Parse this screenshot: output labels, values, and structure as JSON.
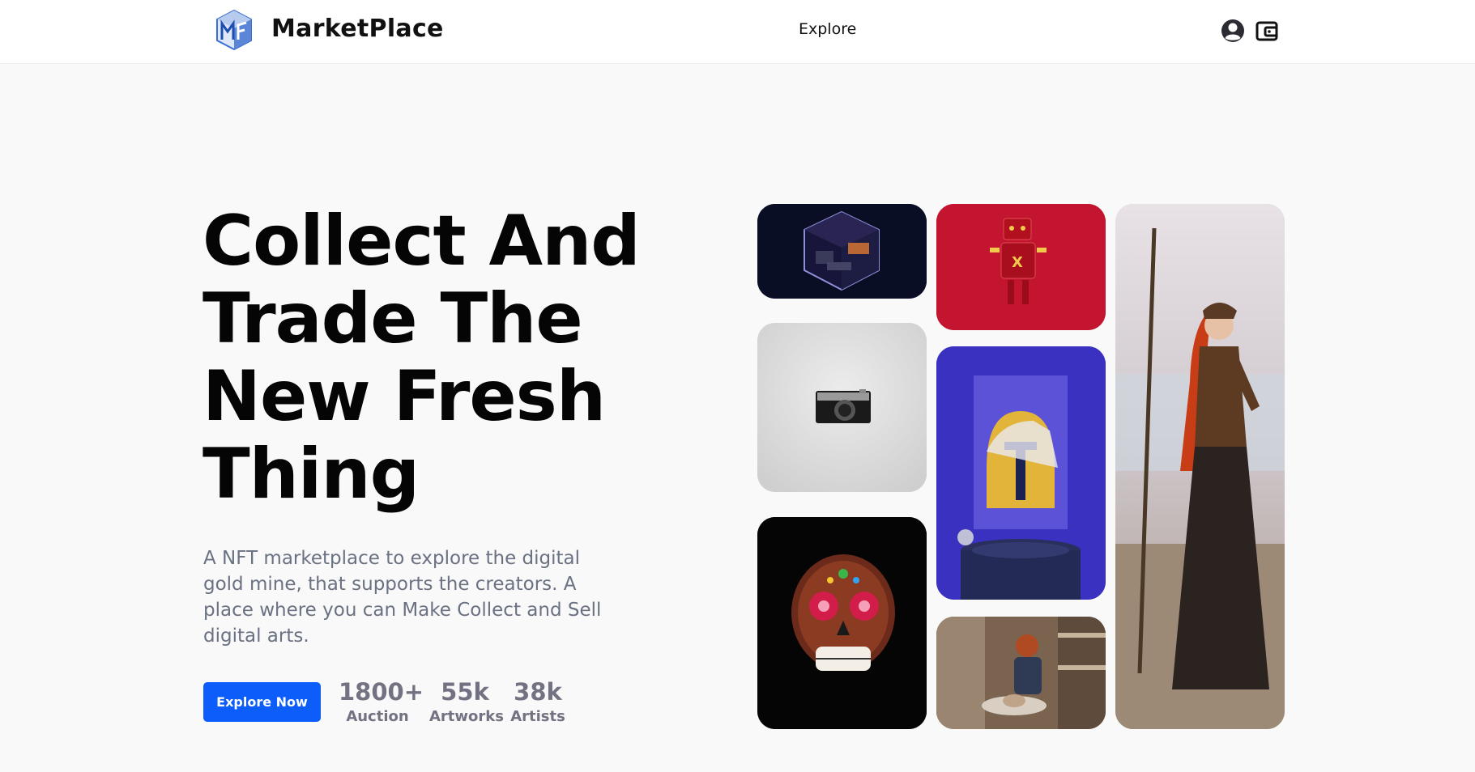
{
  "navbar": {
    "brand": "MarketPlace",
    "links": [
      "Explore"
    ],
    "icons": [
      "user-icon",
      "wallet-icon"
    ]
  },
  "hero": {
    "headline_lines": [
      "Collect And",
      "Trade The",
      "New Fresh",
      "Thing"
    ],
    "description": "A NFT marketplace to explore the digital gold mine, that supports the creators. A place where you can Make Collect and Sell digital arts.",
    "cta_label": "Explore Now",
    "stats": [
      {
        "value": "1800+",
        "label": "Auction"
      },
      {
        "value": "55k",
        "label": "Artworks"
      },
      {
        "value": "38k",
        "label": "Artists"
      }
    ]
  },
  "gallery": [
    "isometric-room-art",
    "camera-art",
    "sugar-skull-art",
    "red-robot-art",
    "mandalorian-helmet-art",
    "pottery-artist-photo",
    "forest-warrior-photo"
  ],
  "colors": {
    "accent": "#0d5dfb",
    "background": "#f9f9f9",
    "headline": "#050505",
    "muted_text": "#6a7182",
    "stat_text": "#727282"
  }
}
